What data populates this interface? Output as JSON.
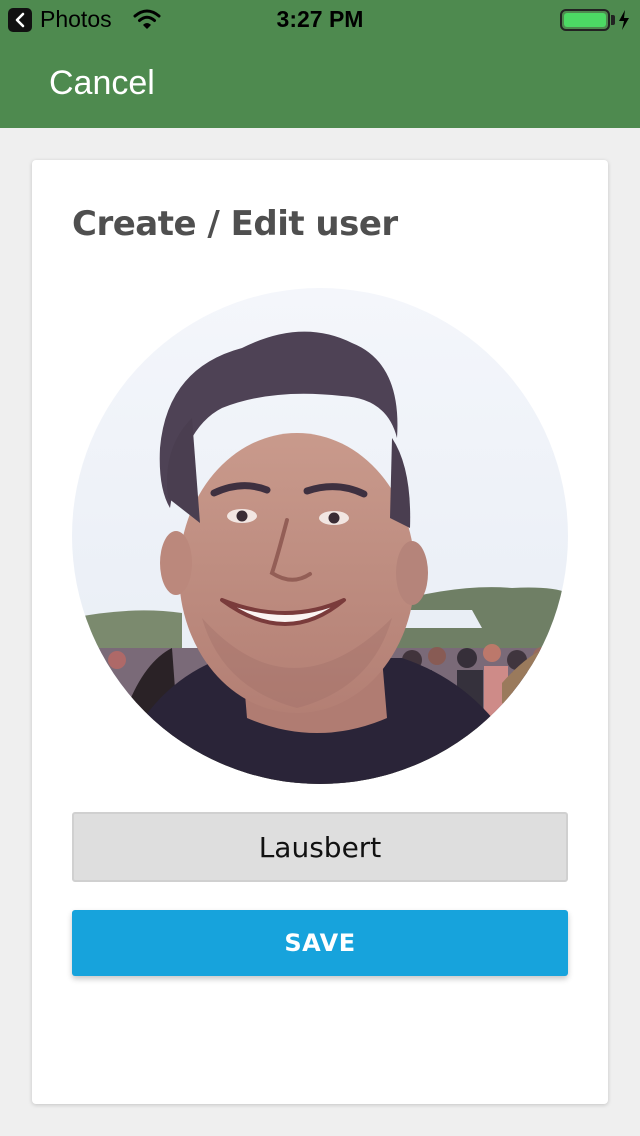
{
  "status_bar": {
    "back_app": "Photos",
    "time": "3:27 PM",
    "battery_level": 1.0,
    "battery_color": "#4cd964"
  },
  "nav": {
    "cancel_label": "Cancel",
    "bar_color": "#4e8a4f"
  },
  "form": {
    "title": "Create / Edit user",
    "avatar_icon": "user-photo",
    "name_value": "Lausbert",
    "save_label": "SAVE",
    "save_color": "#17a3dc"
  }
}
